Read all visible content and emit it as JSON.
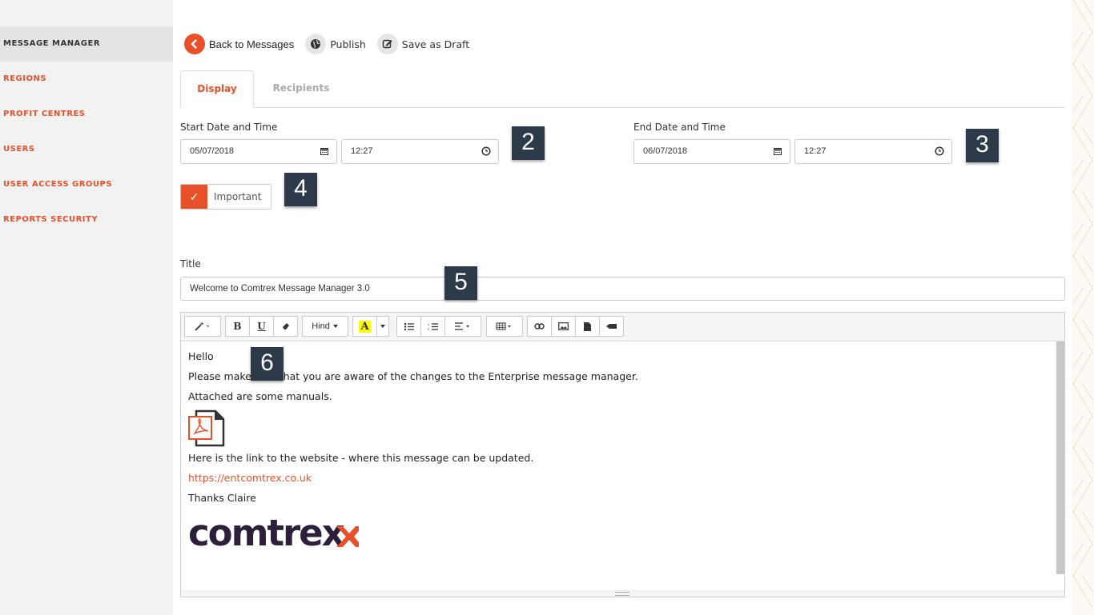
{
  "sidebar": {
    "items": [
      {
        "label": "MESSAGE MANAGER",
        "active": true
      },
      {
        "label": "REGIONS"
      },
      {
        "label": "PROFIT CENTRES"
      },
      {
        "label": "USERS"
      },
      {
        "label": "USER ACCESS GROUPS"
      },
      {
        "label": "REPORTS SECURITY"
      }
    ]
  },
  "toolbar": {
    "back_label": "Back to Messages",
    "publish_label": "Publish",
    "draft_label": "Save as Draft"
  },
  "tabs": [
    {
      "label": "Display",
      "active": true
    },
    {
      "label": "Recipients"
    }
  ],
  "start": {
    "label": "Start Date and Time",
    "date": "05/07/2018",
    "time": "12:27"
  },
  "end": {
    "label": "End Date and Time",
    "date": "06/07/2018",
    "time": "12:27"
  },
  "important": {
    "label": "Important",
    "checked": true,
    "checkmark": "✓"
  },
  "title": {
    "label": "Title",
    "value": "Welcome to Comtrex Message Manager 3.0"
  },
  "editor": {
    "toolbar": {
      "font_label": "Hind",
      "font_color_letter": "A"
    },
    "body": {
      "greeting": "Hello",
      "line1": "Please make sure that you are aware of the changes to the Enterprise message manager.",
      "line2": "Attached are some manuals.",
      "line3": "Here is the link to the website - where this message can be updated.",
      "link": "https://entcomtrex.co.uk",
      "signoff": "Thanks Claire",
      "logo_text": "comtrex"
    }
  },
  "badges": [
    "2",
    "3",
    "4",
    "5",
    "6"
  ],
  "colors": {
    "accent": "#e8502a",
    "badge": "#2d3a4a"
  }
}
